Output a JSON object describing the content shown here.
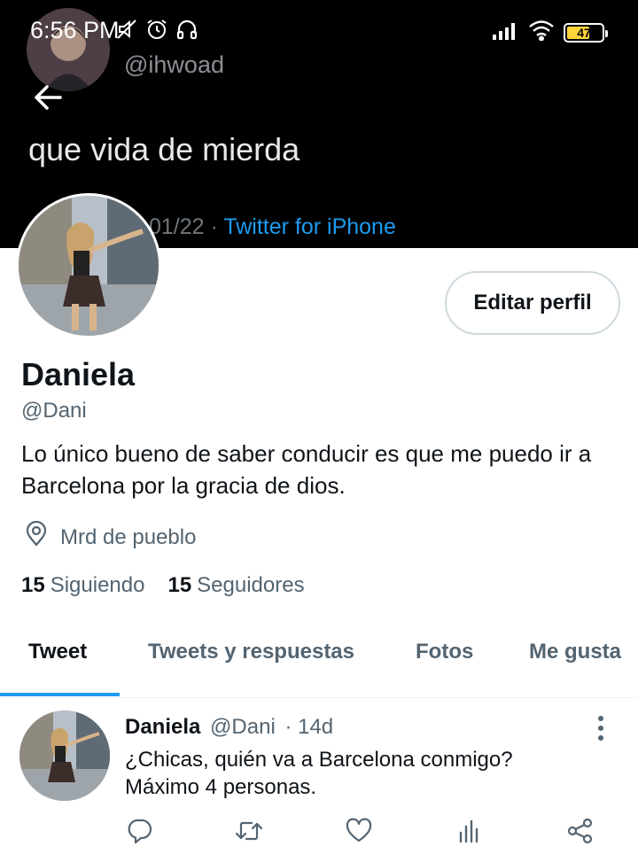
{
  "status_bar": {
    "time": "6:56 PM",
    "battery": "47"
  },
  "banner": {
    "handle": "@ihwoad",
    "tweet_text": "que vida de mierda",
    "date_fragment": "01/22",
    "separator": " · ",
    "source": "Twitter for iPhone"
  },
  "profile": {
    "edit_label": "Editar perfil",
    "display_name": "Daniela",
    "username": "@Dani",
    "bio": "Lo único bueno de saber conducir es que me puedo ir a Barcelona por la gracia de dios.",
    "location": "Mrd de pueblo",
    "following_count": "15",
    "following_label": "Siguiendo",
    "followers_count": "15",
    "followers_label": "Seguidores"
  },
  "tabs": [
    {
      "label": "Tweet"
    },
    {
      "label": "Tweets y respuestas"
    },
    {
      "label": "Fotos"
    },
    {
      "label": "Me gusta"
    }
  ],
  "tweet": {
    "name": "Daniela",
    "handle": "@Dani",
    "time": "· 14d",
    "text_line1": "¿Chicas, quién va a Barcelona conmigo?",
    "text_line2": "Máximo 4 personas."
  },
  "icons": {
    "back": "arrow-left-icon",
    "location": "map-pin-icon",
    "reply": "reply-icon",
    "retweet": "retweet-icon",
    "like": "heart-icon",
    "analytics": "analytics-icon",
    "share": "share-icon"
  },
  "colors": {
    "accent": "#1d9bf0",
    "text_primary": "#0f1419",
    "text_secondary": "#536471",
    "banner_bg": "#000000"
  }
}
